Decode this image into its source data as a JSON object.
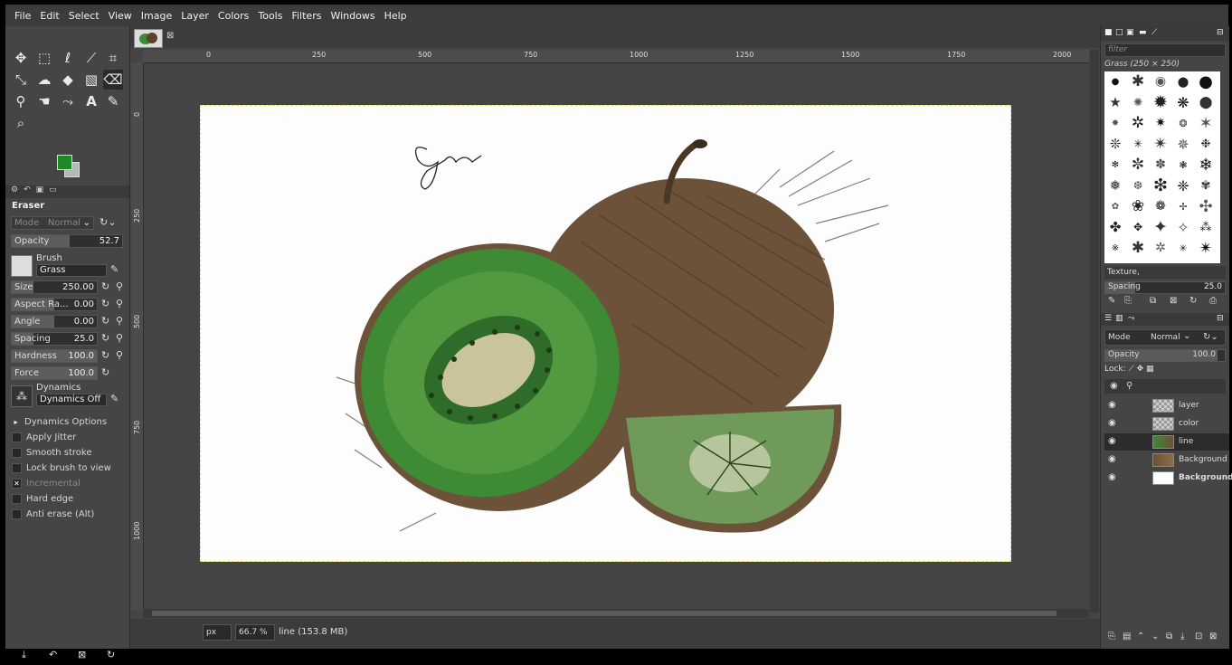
{
  "menu": [
    "File",
    "Edit",
    "Select",
    "View",
    "Image",
    "Layer",
    "Colors",
    "Tools",
    "Filters",
    "Windows",
    "Help"
  ],
  "tool_options": {
    "tabs": [
      "device-status",
      "undo-history",
      "tool-options",
      "images"
    ],
    "tool_name": "Eraser",
    "mode_label": "Mode",
    "mode_value": "Normal",
    "opacity": {
      "label": "Opacity",
      "value": "52.7",
      "fraction": 0.527
    },
    "brush_label": "Brush",
    "brush_value": "Grass",
    "size": {
      "label": "Size",
      "value": "250.00",
      "fraction": 0.25
    },
    "aspect": {
      "label": "Aspect Ra...",
      "value": "0.00",
      "fraction": 0.5
    },
    "angle": {
      "label": "Angle",
      "value": "0.00",
      "fraction": 0.5
    },
    "spacing": {
      "label": "Spacing",
      "value": "25.0",
      "fraction": 0.25
    },
    "hardness": {
      "label": "Hardness",
      "value": "100.0",
      "fraction": 1.0
    },
    "force": {
      "label": "Force",
      "value": "100.0",
      "fraction": 1.0
    },
    "dynamics_label": "Dynamics",
    "dynamics_value": "Dynamics Off",
    "options": [
      {
        "label": "Dynamics Options",
        "checked": false,
        "expander": true
      },
      {
        "label": "Apply Jitter",
        "checked": false
      },
      {
        "label": "Smooth stroke",
        "checked": false
      },
      {
        "label": "Lock brush to view",
        "checked": false
      },
      {
        "label": "Incremental",
        "checked": true,
        "dim": true
      },
      {
        "label": "Hard edge",
        "checked": false
      },
      {
        "label": "Anti erase  (Alt)",
        "checked": false
      }
    ]
  },
  "colors": {
    "foreground": "#1f8a2a",
    "background": "#b8b8b8"
  },
  "ruler": {
    "h": [
      "0",
      "250",
      "500",
      "750",
      "1000",
      "1250",
      "1500",
      "1750",
      "2000"
    ],
    "v": [
      "0",
      "250",
      "500",
      "750",
      "1000"
    ]
  },
  "status": {
    "unit": "px",
    "zoom": "66.7 %",
    "info": "line (153.8 MB)"
  },
  "brushes": {
    "filter_placeholder": "filter",
    "selected": "Grass (250 × 250)",
    "tag": "Texture,",
    "spacing": {
      "label": "Spacing",
      "value": "25.0",
      "fraction": 0.25
    }
  },
  "layers": {
    "mode_label": "Mode",
    "mode_value": "Normal",
    "opacity": {
      "label": "Opacity",
      "value": "100.0",
      "fraction": 1.0
    },
    "lock_label": "Lock:",
    "items": [
      {
        "name": "layer",
        "thumb": "checker",
        "selected": false
      },
      {
        "name": "color",
        "thumb": "checker",
        "selected": false
      },
      {
        "name": "line",
        "thumb": "kiwi",
        "selected": true
      },
      {
        "name": "Background",
        "thumb": "brown",
        "selected": false
      },
      {
        "name": "Background",
        "thumb": "white",
        "selected": false
      }
    ]
  }
}
